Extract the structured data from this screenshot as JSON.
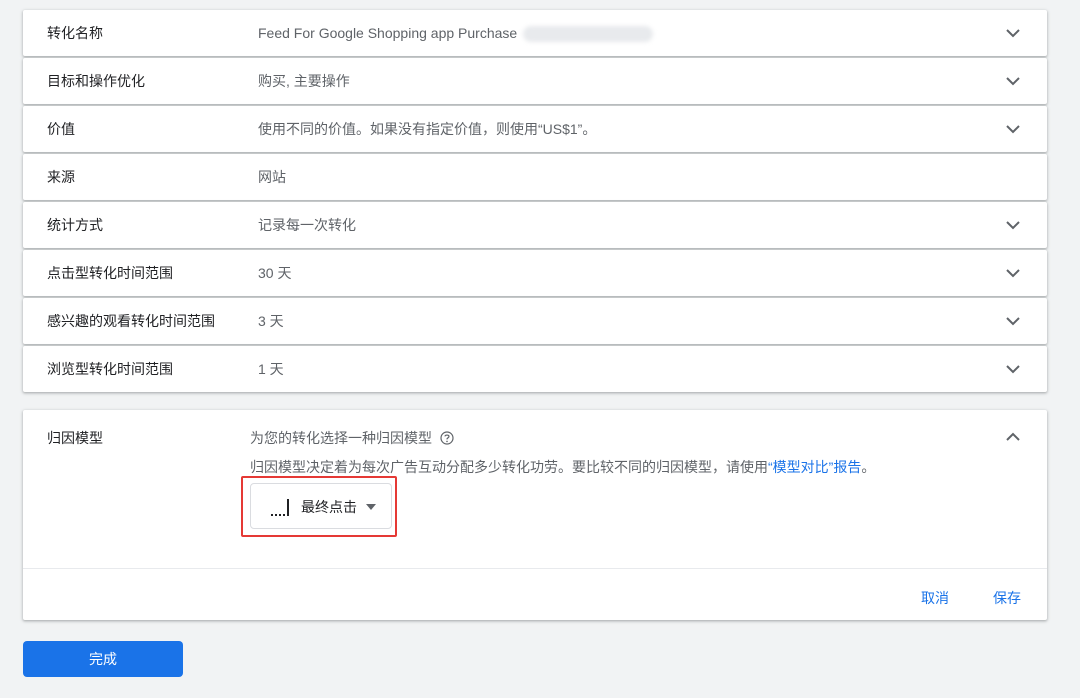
{
  "settings": {
    "rows": [
      {
        "label": "转化名称",
        "value": "Feed For Google Shopping app Purchase",
        "expandable": true,
        "redacted": true
      },
      {
        "label": "目标和操作优化",
        "value": "购买, 主要操作",
        "expandable": true
      },
      {
        "label": "价值",
        "value": "使用不同的价值。如果没有指定价值，则使用“US$1”。",
        "expandable": true
      },
      {
        "label": "来源",
        "value": "网站",
        "expandable": false
      },
      {
        "label": "统计方式",
        "value": "记录每一次转化",
        "expandable": true
      },
      {
        "label": "点击型转化时间范围",
        "value": "30 天",
        "expandable": true
      },
      {
        "label": "感兴趣的观看转化时间范围",
        "value": "3 天",
        "expandable": true
      },
      {
        "label": "浏览型转化时间范围",
        "value": "1 天",
        "expandable": true
      }
    ]
  },
  "attribution": {
    "label": "归因模型",
    "title": "为您的转化选择一种归因模型",
    "description_prefix": "归因模型决定着为每次广告互动分配多少转化功劳。要比较不同的归因模型，请使用",
    "description_link": "“模型对比”报告",
    "description_suffix": "。",
    "selected_model": "最终点击",
    "cancel_label": "取消",
    "save_label": "保存"
  },
  "done_label": "完成",
  "colors": {
    "accent": "#1a73e8",
    "highlight": "#e53935",
    "background": "#f1f3f4"
  }
}
